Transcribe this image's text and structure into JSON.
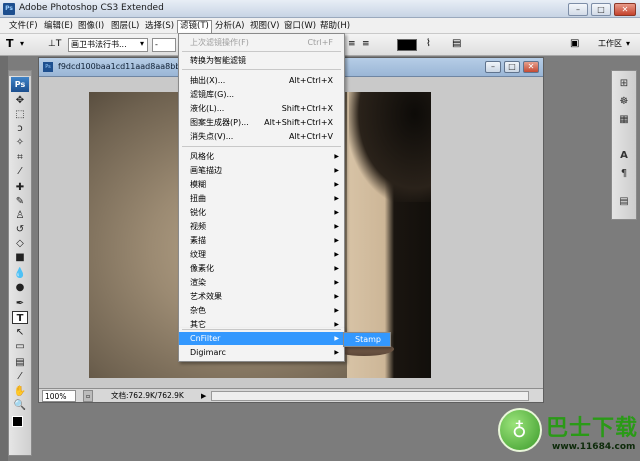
{
  "app": {
    "title": "Adobe Photoshop CS3 Extended",
    "badge": "Ps"
  },
  "window_buttons": {
    "minimize": "–",
    "maximize": "□",
    "close": "✕"
  },
  "menubar": [
    "文件(F)",
    "编辑(E)",
    "图像(I)",
    "图层(L)",
    "选择(S)",
    "滤镜(T)",
    "分析(A)",
    "视图(V)",
    "窗口(W)",
    "帮助(H)"
  ],
  "options": {
    "tool_glyph": "T",
    "font_name": "画卫书法行书...",
    "font_style": "-",
    "color_hex": "#000000",
    "workspace": "工作区"
  },
  "document": {
    "name": "f9dcd100baa1cd11aad8aa8bb9",
    "zoom": "100%",
    "doc_size": "文档:762.9K/762.9K"
  },
  "menu": {
    "last_filter": {
      "label": "上次滤镜操作(F)",
      "shortcut": "Ctrl+F"
    },
    "smart": "转换为智能滤镜",
    "items_top": [
      {
        "label": "抽出(X)...",
        "shortcut": "Alt+Ctrl+X"
      },
      {
        "label": "滤镜库(G)...",
        "shortcut": ""
      },
      {
        "label": "液化(L)...",
        "shortcut": "Shift+Ctrl+X"
      },
      {
        "label": "图案生成器(P)...",
        "shortcut": "Alt+Shift+Ctrl+X"
      },
      {
        "label": "消失点(V)...",
        "shortcut": "Alt+Ctrl+V"
      }
    ],
    "submenus": [
      "风格化",
      "画笔描边",
      "模糊",
      "扭曲",
      "锐化",
      "视频",
      "素描",
      "纹理",
      "像素化",
      "渲染",
      "艺术效果",
      "杂色",
      "其它"
    ],
    "plugins": [
      "CnFilter",
      "Digimarc"
    ],
    "cnfilter_sub": "Stamp"
  },
  "watermark": {
    "name": "巴士下载",
    "url": "www.11684.com"
  },
  "colors": {
    "highlight": "#3398fe",
    "title_blue": "#9ab6d6"
  }
}
